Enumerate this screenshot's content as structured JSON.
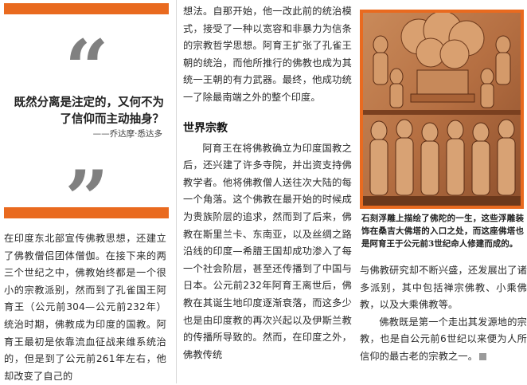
{
  "quote": {
    "open_mark": "“",
    "close_mark": "”",
    "text": "既然分离是注定的，又何不为了信仰而主动抽身？",
    "author": "——乔达摩·悉达多"
  },
  "left_column": {
    "paragraph": "在印度东北部宣传佛教思想，还建立了佛教僧侣团体僧伽。在接下来的两三个世纪之中，佛教始终都是一个很小的宗教派别，然而到了孔雀国王阿育王（公元前304—公元前232年）统治时期，佛教成为印度的国教。阿育王最初是依靠流血征战来维系统治的，但是到了公元前261年左右，他却改变了自己的"
  },
  "middle_column": {
    "paragraph_1": "想法。自那开始，他一改此前的统治模式，接受了一种以宽容和非暴力为信条的宗教哲学思想。阿育王扩张了孔雀王朝的统治，而他所推行的佛教也成为其统一王朝的有力武器。最终，他成功统一了除最南端之外的整个印度。",
    "section_title": "世界宗教",
    "paragraph_2": "阿育王在将佛教确立为印度国教之后，还兴建了许多寺院，并出资支持佛教学者。他将佛教僧人送往次大陆的每一个角落。这个佛教在最开始的时候成为贵族阶层的追求，然而到了后来，佛教在斯里兰卡、东南亚，以及丝绸之路沿线的印度—希腊王国却成功渗入了每一个社会阶层，甚至还传播到了中国与日本。公元前232年阿育王离世后，佛教在其诞生地印度逐渐衰落，而这多少也是由印度教的再次兴起以及伊斯兰教的传播所导致的。然而，在印度之外，佛教传统"
  },
  "right_column": {
    "caption": "石刻浮雕上描绘了佛陀的一生，这些浮雕装饰在桑吉大佛塔的入口之处，而这座佛塔也是阿育王于公元前3世纪命人修建而成的。",
    "paragraph_1": "与佛教研究却不断兴盛，还发展出了诸多派别，其中包括禅宗佛教、小乘佛教，以及大乘佛教等。",
    "paragraph_2": "佛教既是第一个走出其发源地的宗教，也是自公元前6世纪以来便为人所信仰的最古老的宗教之一。"
  },
  "colors": {
    "accent_orange": "#e96a1f",
    "quote_mark_gray": "#808080",
    "stone_relief": "#b86a3a"
  },
  "icons": {
    "end_mark": "square-end-mark-icon"
  }
}
